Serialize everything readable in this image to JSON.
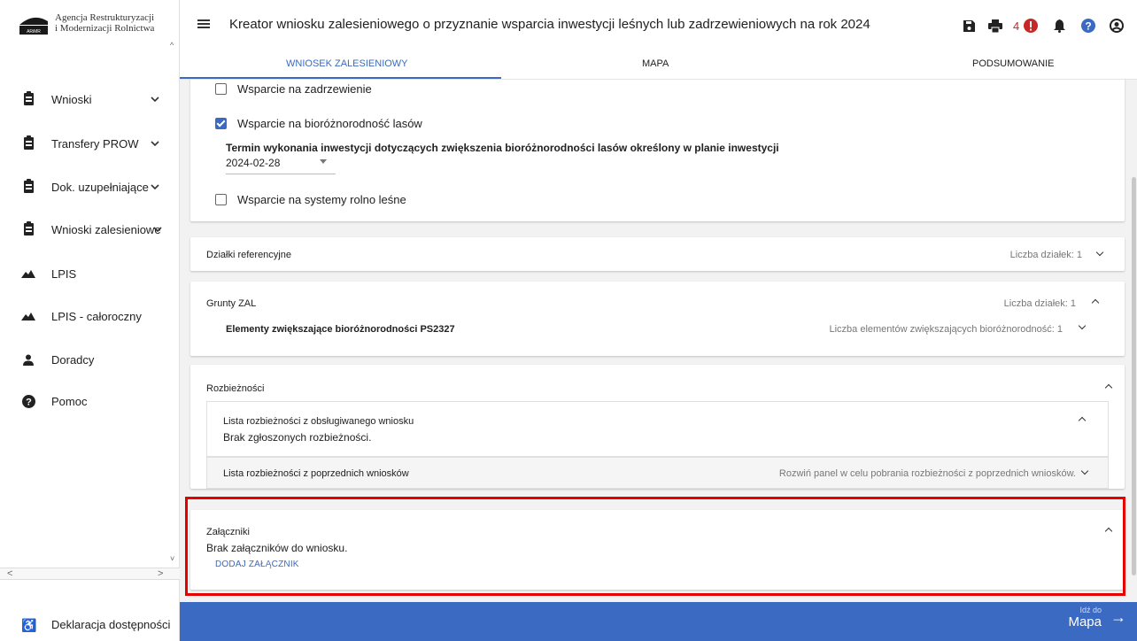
{
  "app": {
    "agency_line1": "Agencja Restrukturyzacji",
    "agency_line2": "i Modernizacji Rolnictwa",
    "title": "Kreator wniosku zalesieniowego o przyznanie wsparcia inwestycji leśnych lub zadrzewieniowych na rok 2024",
    "notification_count": "4"
  },
  "sidebar": {
    "items": [
      {
        "label": "Wnioski",
        "icon": "clipboard-icon"
      },
      {
        "label": "Transfery PROW",
        "icon": "clipboard-icon"
      },
      {
        "label": "Dok. uzupełniające",
        "icon": "clipboard-icon"
      },
      {
        "label": "Wnioski zalesieniowe",
        "icon": "clipboard-icon"
      },
      {
        "label": "LPIS",
        "icon": "mountain-icon"
      },
      {
        "label": "LPIS - całoroczny",
        "icon": "mountain-icon"
      },
      {
        "label": "Doradcy",
        "icon": "person-icon"
      },
      {
        "label": "Pomoc",
        "icon": "help-icon"
      }
    ],
    "declaration": "Deklaracja dostępności"
  },
  "tabs": [
    "WNIOSEK ZALESIENIOWY",
    "MAPA",
    "PODSUMOWANIE"
  ],
  "form": {
    "cb_zadrzewienie": "Wsparcie na zadrzewienie",
    "cb_bioroznorodnosc": "Wsparcie na bioróżnorodność lasów",
    "termin_label": "Termin wykonania inwestycji dotyczących zwiększenia bioróżnorodności lasów określony w planie inwestycji",
    "termin_value": "2024-02-28",
    "cb_systemy": "Wsparcie na systemy rolno leśne"
  },
  "panels": {
    "dzialki": {
      "title": "Działki referencyjne",
      "count": "Liczba działek: 1"
    },
    "grunty": {
      "title": "Grunty ZAL",
      "count": "Liczba działek: 1",
      "sub_title": "Elementy zwiększające bioróżnorodności PS2327",
      "sub_count": "Liczba elementów zwiększających bioróżnorodność: 1"
    },
    "rozbieznosci": {
      "title": "Rozbieżności",
      "current_title": "Lista rozbieżności z obsługiwanego wniosku",
      "current_text": "Brak zgłoszonych rozbieżności.",
      "previous_title": "Lista rozbieżności z poprzednich wniosków",
      "previous_hint": "Rozwiń panel w celu pobrania rozbieżności z poprzednich wniosków."
    },
    "zalaczniki": {
      "title": "Załączniki",
      "text": "Brak załączników do wniosku.",
      "add_button": "DODAJ ZAŁĄCZNIK"
    }
  },
  "footer": {
    "goto_small": "Idź do",
    "goto_big": "Mapa"
  },
  "colors": {
    "accent": "#3a6ac1",
    "highlight": "#e50000",
    "alert": "#c62828"
  }
}
